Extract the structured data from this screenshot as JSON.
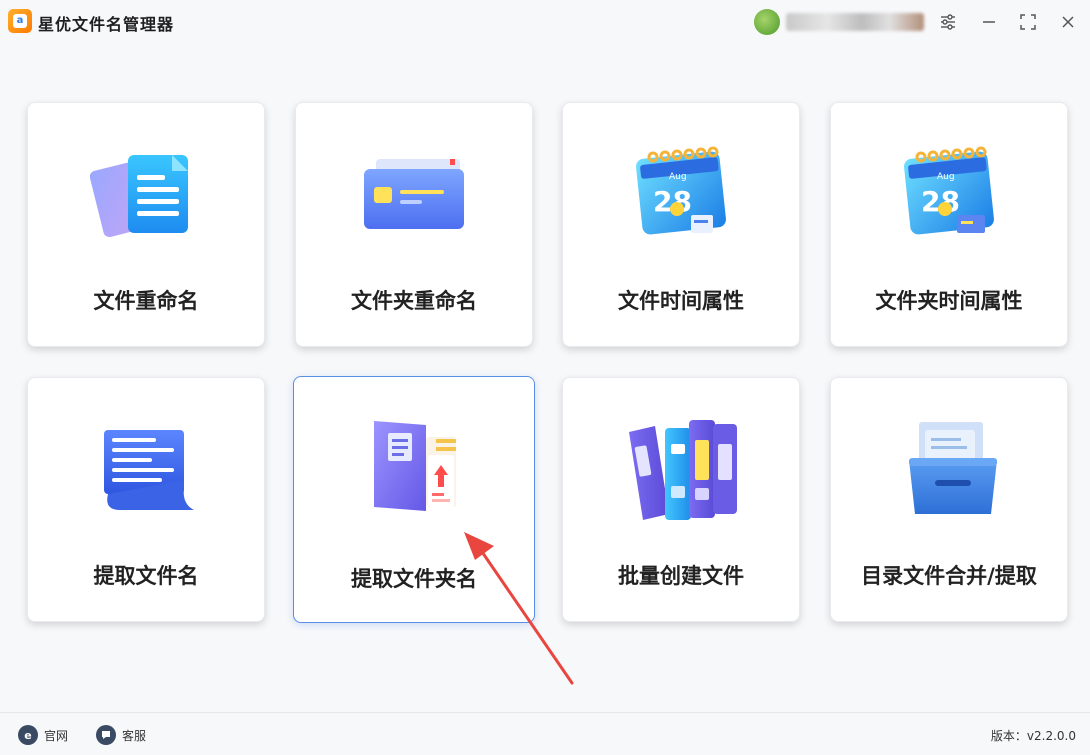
{
  "app": {
    "title": "星优文件名管理器",
    "logo_text": "a",
    "username": "user"
  },
  "window_controls": {
    "settings_icon": "sliders-icon",
    "minimize_icon": "minimize-icon",
    "maximize_icon": "maximize-icon",
    "close_icon": "close-icon"
  },
  "cards": [
    {
      "label": "文件重命名",
      "icon": "document-icon"
    },
    {
      "label": "文件夹重命名",
      "icon": "folder-icon"
    },
    {
      "label": "文件时间属性",
      "icon": "calendar-icon",
      "calendar_month": "Aug",
      "calendar_day": "28"
    },
    {
      "label": "文件夹时间属性",
      "icon": "calendar-folder-icon",
      "calendar_month": "Aug",
      "calendar_day": "28"
    },
    {
      "label": "提取文件名",
      "icon": "scroll-icon"
    },
    {
      "label": "提取文件夹名",
      "icon": "book-folder-icon",
      "selected": true
    },
    {
      "label": "批量创建文件",
      "icon": "binders-icon"
    },
    {
      "label": "目录文件合并/提取",
      "icon": "file-drawer-icon"
    }
  ],
  "footer": {
    "website_label": "官网",
    "website_icon_text": "e",
    "support_label": "客服",
    "version_text": "版本：v2.2.0.0"
  },
  "colors": {
    "accent_blue": "#5a8fe6",
    "arrow_red": "#e8463f"
  }
}
